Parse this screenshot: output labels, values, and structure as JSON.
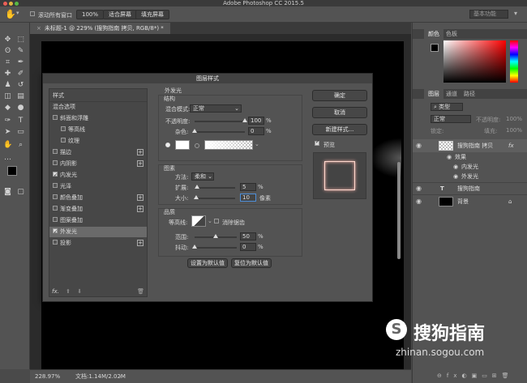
{
  "window": {
    "title": "Adobe Photoshop CC 2015.5"
  },
  "options_bar": {
    "scroll_all_label": "滚动所有窗口",
    "zoom_100": "100%",
    "fit_screen": "适合屏幕",
    "fill_screen": "填充屏幕",
    "workspace": "基本功能"
  },
  "document": {
    "tab_title": "未标题-1 @ 229% (搜狗指南 拷贝, RGB/8*) *",
    "zoom": "228.97%",
    "doc_size": "文档:1.14M/2.02M"
  },
  "dialog": {
    "title": "图层样式",
    "styles_header": "样式",
    "blend_options": "混合选项",
    "style_items": [
      {
        "label": "斜面和浮雕",
        "checked": false,
        "plus": false,
        "indent": false
      },
      {
        "label": "等高线",
        "checked": false,
        "plus": false,
        "indent": true
      },
      {
        "label": "纹理",
        "checked": false,
        "plus": false,
        "indent": true
      },
      {
        "label": "描边",
        "checked": false,
        "plus": true,
        "indent": false
      },
      {
        "label": "内阴影",
        "checked": false,
        "plus": true,
        "indent": false
      },
      {
        "label": "内发光",
        "checked": true,
        "plus": false,
        "indent": false
      },
      {
        "label": "光泽",
        "checked": false,
        "plus": false,
        "indent": false
      },
      {
        "label": "颜色叠加",
        "checked": false,
        "plus": true,
        "indent": false
      },
      {
        "label": "渐变叠加",
        "checked": false,
        "plus": true,
        "indent": false
      },
      {
        "label": "图案叠加",
        "checked": false,
        "plus": false,
        "indent": false
      },
      {
        "label": "外发光",
        "checked": true,
        "plus": false,
        "indent": false,
        "selected": true
      },
      {
        "label": "投影",
        "checked": false,
        "plus": true,
        "indent": false
      }
    ],
    "fx_label": "fx.",
    "section_title": "外发光",
    "structure": {
      "title": "结构",
      "blend_mode_label": "混合模式:",
      "blend_mode": "正常",
      "opacity_label": "不透明度:",
      "opacity": "100",
      "noise_label": "杂色:",
      "noise": "0",
      "pct": "%",
      "opacity_level": 1.0,
      "noise_level": 0.0
    },
    "elements": {
      "title": "图素",
      "method_label": "方法:",
      "method": "柔和",
      "spread_label": "扩展:",
      "spread": "5",
      "size_label": "大小:",
      "size": "10",
      "px": "像素",
      "spread_level": 0.05,
      "size_level": 0.04
    },
    "quality": {
      "title": "品质",
      "contour_label": "等高线:",
      "antialias_label": "消除锯齿",
      "range_label": "范围:",
      "range": "50",
      "jitter_label": "抖动:",
      "jitter": "0",
      "range_level": 0.5,
      "jitter_level": 0.0
    },
    "make_default": "设置为默认值",
    "reset_default": "复位为默认值",
    "ok": "确定",
    "cancel": "取消",
    "new_style": "新建样式...",
    "preview_label": "预览"
  },
  "right_panel": {
    "color_tabs": [
      "颜色",
      "色板"
    ],
    "layer_tabs": [
      "图层",
      "通道",
      "路径"
    ],
    "kind_filter": "类型",
    "blend": "正常",
    "opacity_label": "不透明度:",
    "opacity": "100%",
    "lock_label": "锁定:",
    "fill_label": "填充:",
    "fill": "100%",
    "layers": [
      {
        "name": "搜狗指南 拷贝",
        "fx": "fx"
      },
      {
        "name": "效果",
        "sub": true
      },
      {
        "name": "内发光",
        "sub2": true
      },
      {
        "name": "外发光",
        "sub2": true
      },
      {
        "name": "搜狗指南",
        "text": true
      },
      {
        "name": "背景",
        "bg": true
      }
    ]
  },
  "watermark": {
    "brand": "搜狗指南",
    "url": "zhinan.sogou.com"
  },
  "colors": {
    "accent": "#4d8ed8",
    "panel": "#535353",
    "dialog": "#535353",
    "glow": "#e8a9a0"
  }
}
